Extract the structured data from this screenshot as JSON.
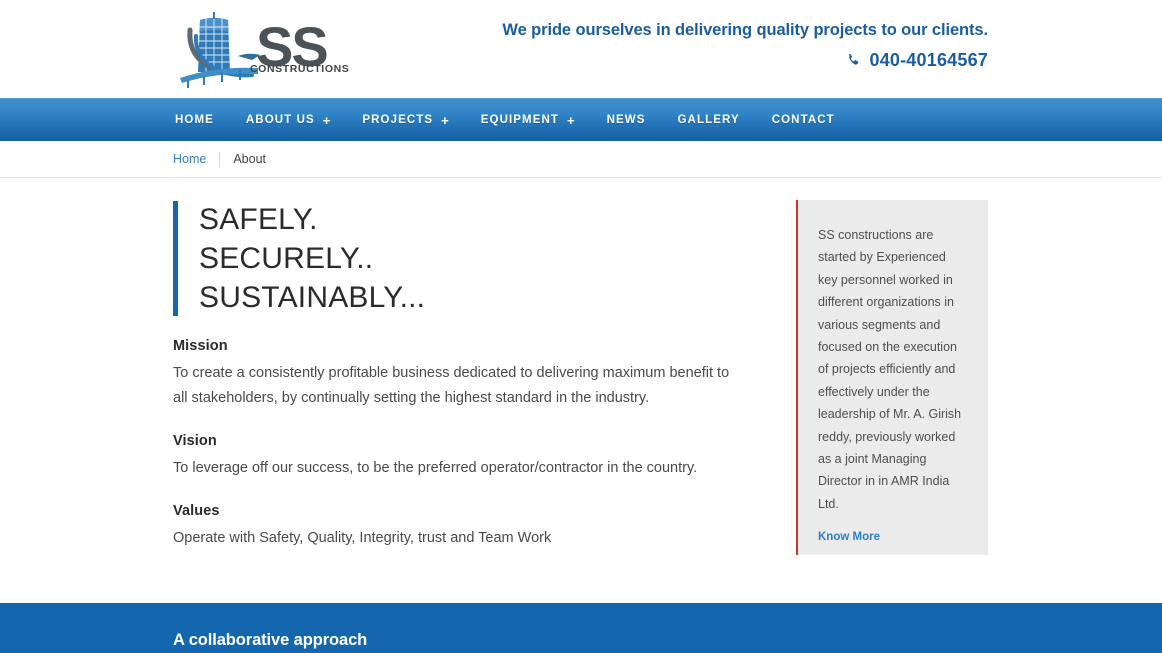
{
  "header": {
    "logo": {
      "brand_text": "SS",
      "sub_text": "CONSTRUCTIONS",
      "alt": "SS Constructions logo"
    },
    "tagline": "We pride ourselves in delivering quality projects to our clients.",
    "phone": "040-40164567",
    "phone_icon": "phone-icon"
  },
  "nav": {
    "items": [
      {
        "label": "HOME",
        "has_submenu": false,
        "plus": ""
      },
      {
        "label": "ABOUT US",
        "has_submenu": true,
        "plus": "+"
      },
      {
        "label": "PROJECTS",
        "has_submenu": true,
        "plus": "+"
      },
      {
        "label": "EQUIPMENT",
        "has_submenu": true,
        "plus": "+"
      },
      {
        "label": "NEWS",
        "has_submenu": false,
        "plus": ""
      },
      {
        "label": "GALLERY",
        "has_submenu": false,
        "plus": ""
      },
      {
        "label": "CONTACT",
        "has_submenu": false,
        "plus": ""
      }
    ]
  },
  "breadcrumb": {
    "home": "Home",
    "current": "About"
  },
  "main": {
    "heading": {
      "line1": "SAFELY.",
      "line2": "SECURELY..",
      "line3": "SUSTAINABLY..."
    },
    "sections": [
      {
        "title": "Mission",
        "body": "To create a consistently profitable business dedicated to delivering maximum benefit to all stakeholders, by continually setting the highest standard in the industry."
      },
      {
        "title": "Vision",
        "body": "To leverage off our success, to be the preferred operator/contractor in the country."
      },
      {
        "title": "Values",
        "body": "Operate with Safety, Quality, Integrity, trust and Team Work"
      }
    ]
  },
  "sidebar": {
    "text": "SS constructions are started by Experienced key personnel worked in different organizations in various segments and focused on the execution of projects efficiently and effectively under the leadership of Mr. A. Girish reddy, previously worked as a joint Managing Director in in AMR India Ltd.",
    "link_label": "Know More"
  },
  "bottom_band": {
    "title": "A collaborative approach"
  },
  "colors": {
    "brand_blue": "#1b5d9e",
    "nav_blue_top": "#3f90cd",
    "nav_blue_bottom": "#15609f",
    "accent_bar": "#1267ad",
    "sidebar_bg": "#ebebeb",
    "sidebar_border": "#c0392b",
    "band_blue": "#1467ae",
    "link_blue": "#3a7fc1"
  }
}
